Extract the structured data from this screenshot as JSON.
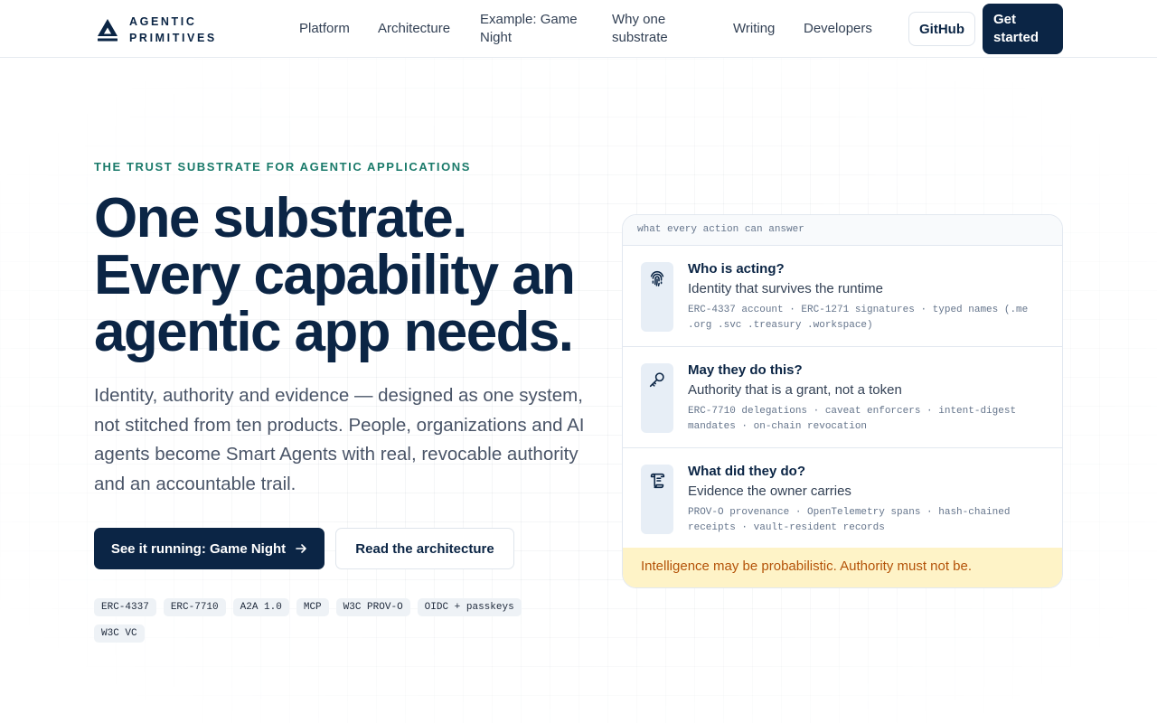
{
  "header": {
    "logo": {
      "line1": "AGENTIC",
      "line2": "PRIMITIVES",
      "icon": "triangle-logo-icon"
    },
    "nav": [
      {
        "label": "Platform"
      },
      {
        "label": "Architecture"
      },
      {
        "label": "Example: Game Night",
        "line1": "Example: Game",
        "line2": "Night"
      },
      {
        "label": "Why one substrate",
        "line1": "Why one",
        "line2": "substrate"
      },
      {
        "label": "Writing"
      },
      {
        "label": "Developers"
      }
    ],
    "github_label": "GitHub",
    "get_started_line1": "Get",
    "get_started_line2": "started"
  },
  "hero": {
    "eyebrow": "THE TRUST SUBSTRATE FOR AGENTIC APPLICATIONS",
    "headline_line1": "One substrate.",
    "headline_line2": "Every capability an",
    "headline_line3": "agentic app needs.",
    "subtitle": "Identity, authority and evidence — designed as one system, not stitched from ten products. People, organizations and AI agents become Smart Agents with real, revocable authority and an accountable trail.",
    "cta_primary": "See it running: Game Night",
    "cta_primary_icon": "arrow-right-icon",
    "cta_secondary": "Read the architecture",
    "tags": [
      "ERC-4337",
      "ERC-7710",
      "A2A 1.0",
      "MCP",
      "W3C PROV-O",
      "OIDC + passkeys",
      "W3C VC"
    ]
  },
  "card": {
    "header": "what every action can answer",
    "rows": [
      {
        "icon": "fingerprint-icon",
        "title": "Who is acting?",
        "subtitle": "Identity that survives the runtime",
        "meta": "ERC-4337 account · ERC-1271 signatures · typed names (.me .org .svc .treasury .workspace)"
      },
      {
        "icon": "key-icon",
        "title": "May they do this?",
        "subtitle": "Authority that is a grant, not a token",
        "meta": "ERC-7710 delegations · caveat enforcers · intent-digest mandates · on-chain revocation"
      },
      {
        "icon": "scroll-icon",
        "title": "What did they do?",
        "subtitle": "Evidence the owner carries",
        "meta": "PROV-O provenance · OpenTelemetry spans · hash-chained receipts · vault-resident records"
      }
    ],
    "footer": "Intelligence may be probabilistic. Authority must not be."
  },
  "colors": {
    "brand_navy": "#0b2545",
    "eyebrow_teal": "#1a7a6a",
    "footer_bg": "#fef3c7",
    "footer_text": "#b45309"
  }
}
